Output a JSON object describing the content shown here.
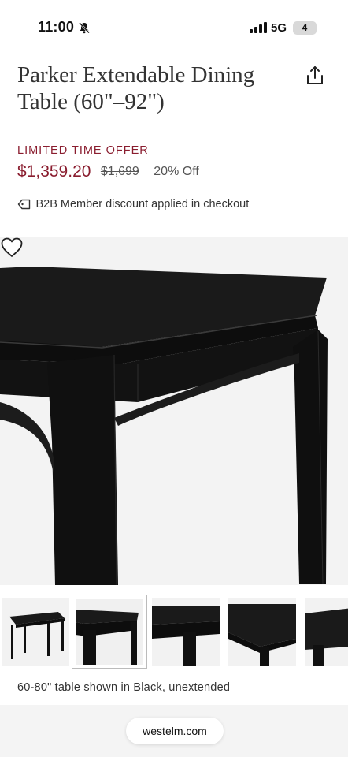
{
  "status_bar": {
    "time": "11:00",
    "network": "5G",
    "battery": "4",
    "icons": [
      "bell-slash-icon",
      "signal-icon"
    ]
  },
  "product": {
    "title": "Parker Extendable Dining Table (60\"–92\")",
    "offer_label": "LIMITED TIME OFFER",
    "sale_price": "$1,359.20",
    "original_price": "$1,699",
    "discount": "20% Off",
    "member_note": "B2B Member discount applied in checkout",
    "caption": "60-80\" table shown in Black, unextended"
  },
  "gallery": {
    "thumbnail_count": 5,
    "selected_index": 1
  },
  "browser": {
    "url": "westelm.com"
  },
  "colors": {
    "accent": "#8a1d2f",
    "table": "#141414"
  }
}
